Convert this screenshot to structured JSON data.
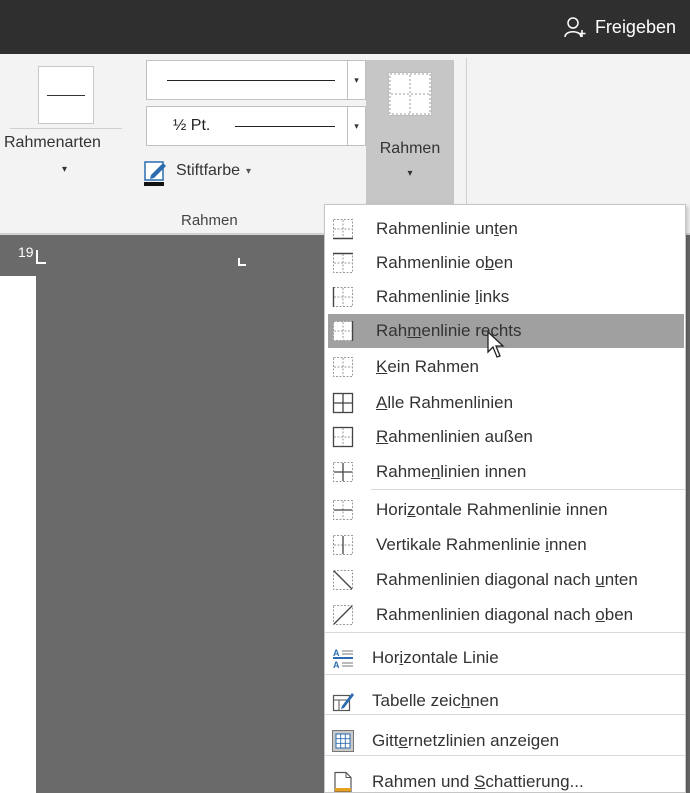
{
  "titlebar": {
    "share_label": "Freigeben",
    "share_icon": "person-add-icon"
  },
  "ribbon": {
    "styles_label": "Rahmenarten",
    "weight_value": "½ Pt.",
    "pen_color_label": "Stiftfarbe",
    "borders_button_label": "Rahmen",
    "group_label": "Rahmen",
    "pen_color": "#111111"
  },
  "ruler": {
    "number": "19"
  },
  "menu": {
    "items": [
      {
        "pre": "Rahmenlinie un",
        "key": "t",
        "post": "en",
        "icon": "border-bottom-icon"
      },
      {
        "pre": "Rahmenlinie o",
        "key": "b",
        "post": "en",
        "icon": "border-top-icon"
      },
      {
        "pre": "Rahmenlinie ",
        "key": "l",
        "post": "inks",
        "icon": "border-left-icon"
      },
      {
        "pre": "Rah",
        "key": "m",
        "post": "enlinie rechts",
        "icon": "border-right-icon"
      },
      {
        "pre": "",
        "key": "K",
        "post": "ein Rahmen",
        "icon": "no-border-icon"
      },
      {
        "pre": "",
        "key": "A",
        "post": "lle Rahmenlinien",
        "icon": "all-borders-icon"
      },
      {
        "pre": "",
        "key": "R",
        "post": "ahmenlinien außen",
        "icon": "outside-borders-icon"
      },
      {
        "pre": "Rahme",
        "key": "n",
        "post": "linien innen",
        "icon": "inside-borders-icon"
      },
      {
        "pre": "Hori",
        "key": "z",
        "post": "ontale Rahmenlinie innen",
        "icon": "inside-horizontal-border-icon"
      },
      {
        "pre": "Vertikale Rahmenlinie ",
        "key": "i",
        "post": "nnen",
        "icon": "inside-vertical-border-icon"
      },
      {
        "pre": "Rahmenlinien diagonal nach ",
        "key": "u",
        "post": "nten",
        "icon": "diagonal-down-border-icon"
      },
      {
        "pre": "Rahmenlinien diagonal nach ",
        "key": "o",
        "post": "ben",
        "icon": "diagonal-up-border-icon"
      },
      {
        "pre": "Hor",
        "key": "i",
        "post": "zontale Linie",
        "icon": "horizontal-line-icon"
      },
      {
        "pre": "Tabelle zeic",
        "key": "h",
        "post": "nen",
        "icon": "draw-table-icon"
      },
      {
        "pre": "Gitt",
        "key": "e",
        "post": "rnetzlinien anzeigen",
        "icon": "view-gridlines-icon"
      },
      {
        "pre": "Rahmen und ",
        "key": "S",
        "post": "chattierung...",
        "icon": "borders-shading-icon"
      }
    ],
    "highlighted_index": 3,
    "highlight_color": "#a0a0a0"
  }
}
